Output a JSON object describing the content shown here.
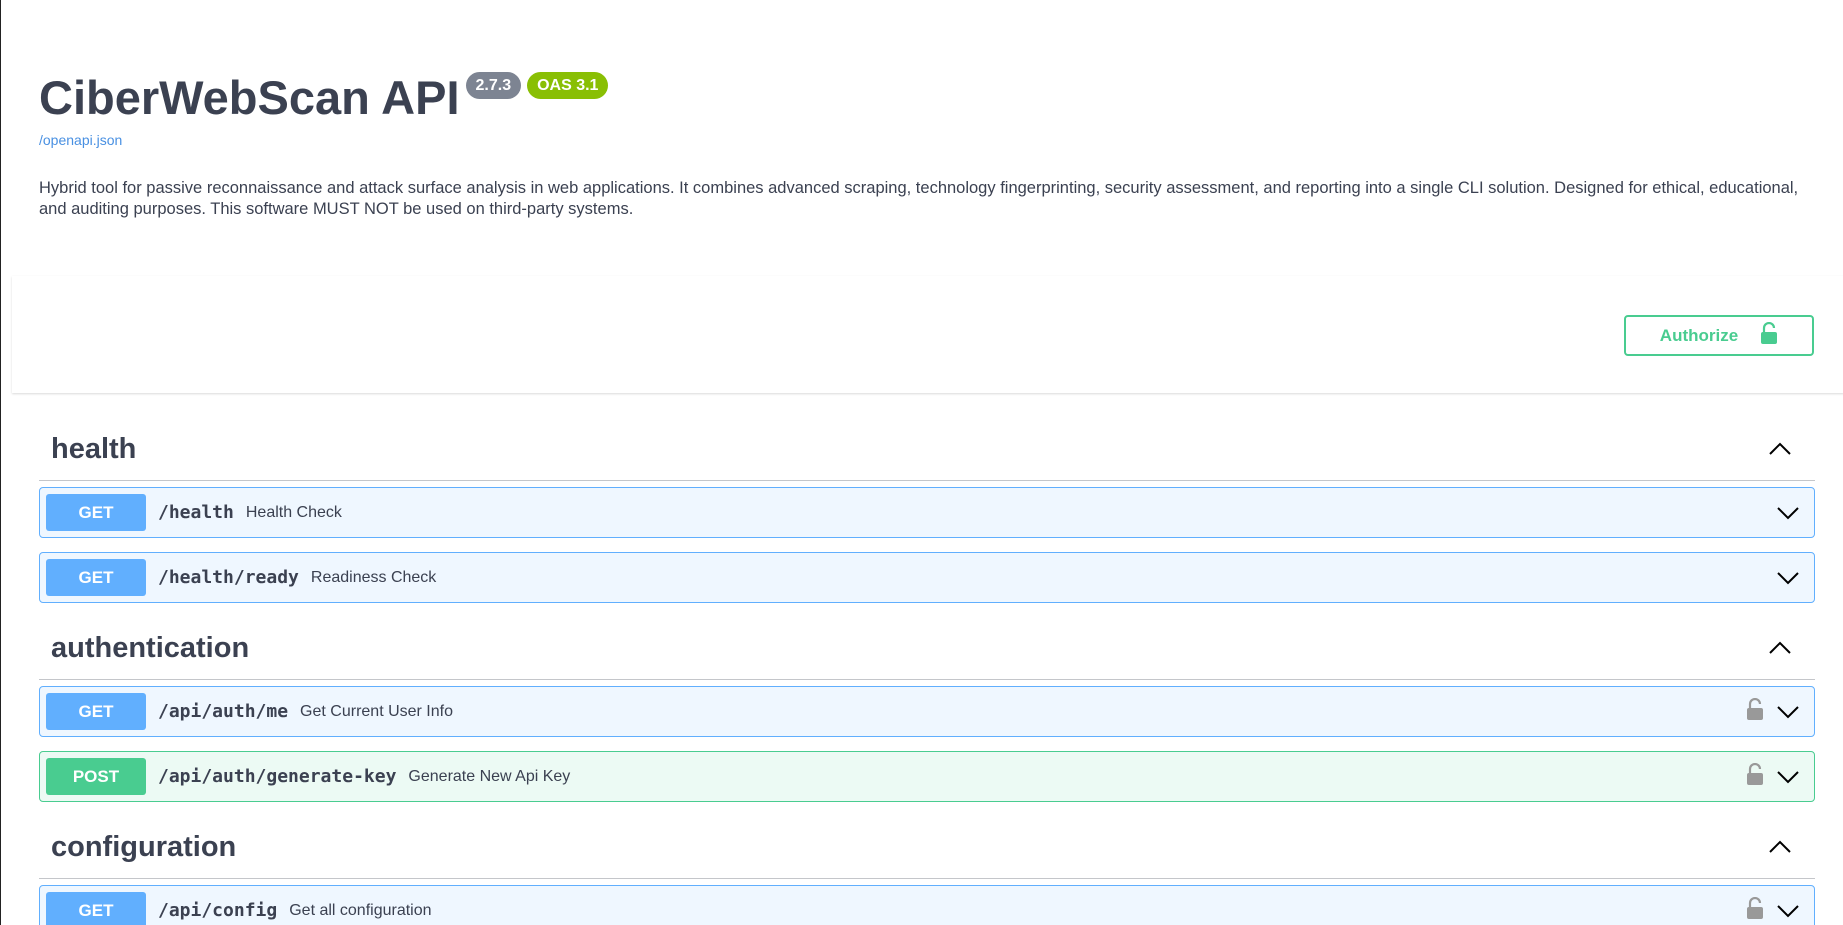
{
  "info": {
    "title": "CiberWebScan API",
    "version": "2.7.3",
    "oas": "OAS 3.1",
    "spec_link": "/openapi.json",
    "description": "Hybrid tool for passive reconnaissance and attack surface analysis in web applications. It combines advanced scraping, technology fingerprinting, security assessment, and reporting into a single CLI solution. Designed for ethical, educational, and auditing purposes. This software MUST NOT be used on third-party systems."
  },
  "authorize": {
    "label": "Authorize",
    "icon": "unlock-icon",
    "color": "#49cc90"
  },
  "colors": {
    "get": "#61affe",
    "post": "#49cc90",
    "text": "#3b4151"
  },
  "tags": [
    {
      "name": "health",
      "operations": [
        {
          "method": "GET",
          "path": "/health",
          "summary": "Health Check",
          "locked": false
        },
        {
          "method": "GET",
          "path": "/health/ready",
          "summary": "Readiness Check",
          "locked": false
        }
      ]
    },
    {
      "name": "authentication",
      "operations": [
        {
          "method": "GET",
          "path": "/api/auth/me",
          "summary": "Get Current User Info",
          "locked": true
        },
        {
          "method": "POST",
          "path": "/api/auth/generate-key",
          "summary": "Generate New Api Key",
          "locked": true
        }
      ]
    },
    {
      "name": "configuration",
      "operations": [
        {
          "method": "GET",
          "path": "/api/config",
          "summary": "Get all configuration",
          "locked": true
        }
      ]
    }
  ]
}
